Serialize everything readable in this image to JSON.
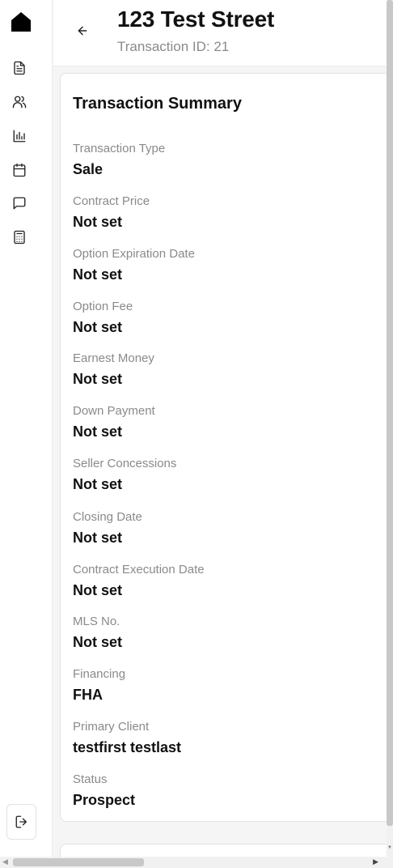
{
  "header": {
    "title": "123 Test Street",
    "subtitle": "Transaction ID: 21"
  },
  "sidebar": {
    "items": [
      {
        "icon": "document-icon"
      },
      {
        "icon": "users-icon"
      },
      {
        "icon": "bar-chart-icon"
      },
      {
        "icon": "calendar-icon"
      },
      {
        "icon": "message-icon"
      },
      {
        "icon": "calculator-icon"
      }
    ],
    "logout_icon": "logout-icon"
  },
  "summary": {
    "title": "Transaction Summary",
    "fields": [
      {
        "label": "Transaction Type",
        "value": "Sale"
      },
      {
        "label": "Contract Price",
        "value": "Not set"
      },
      {
        "label": "Option Expiration Date",
        "value": "Not set"
      },
      {
        "label": "Option Fee",
        "value": "Not set"
      },
      {
        "label": "Earnest Money",
        "value": "Not set"
      },
      {
        "label": "Down Payment",
        "value": "Not set"
      },
      {
        "label": "Seller Concessions",
        "value": "Not set"
      },
      {
        "label": "Closing Date",
        "value": "Not set"
      },
      {
        "label": "Contract Execution Date",
        "value": "Not set"
      },
      {
        "label": "MLS No.",
        "value": "Not set"
      },
      {
        "label": "Financing",
        "value": "FHA"
      },
      {
        "label": "Primary Client",
        "value": "testfirst testlast"
      },
      {
        "label": "Status",
        "value": "Prospect"
      }
    ]
  }
}
